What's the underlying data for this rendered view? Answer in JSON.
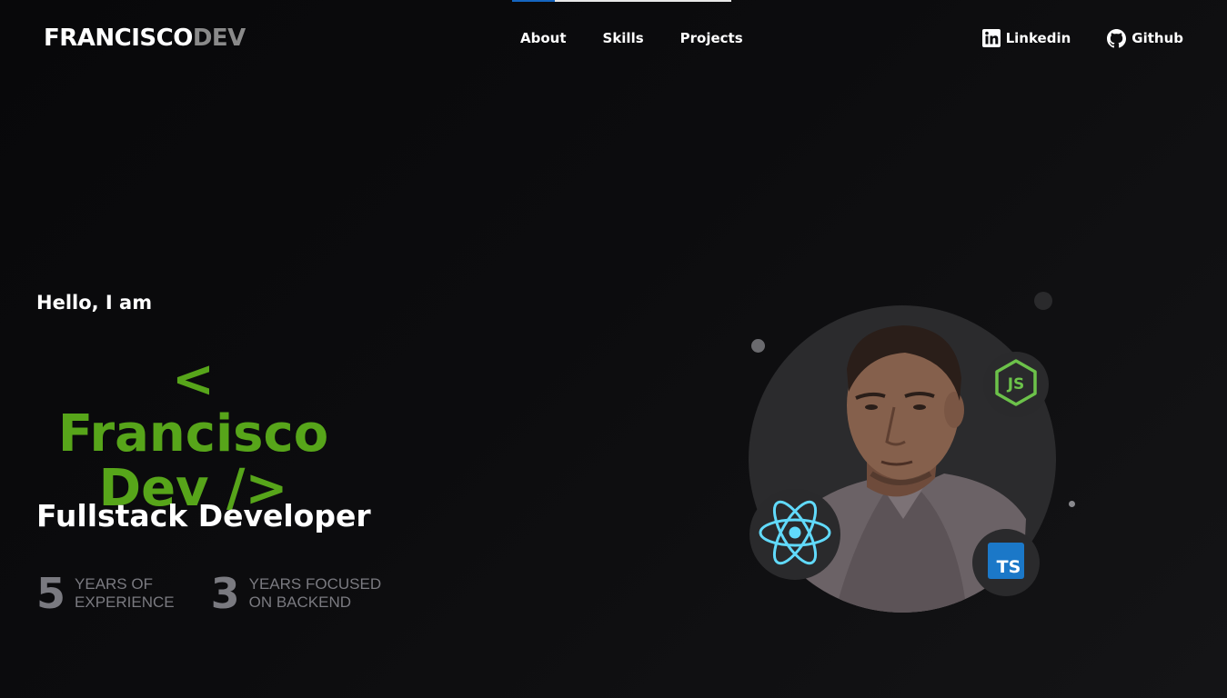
{
  "header": {
    "logo_primary": "FRANCISCO",
    "logo_secondary": "DEV",
    "nav": [
      {
        "label": "About"
      },
      {
        "label": "Skills"
      },
      {
        "label": "Projects"
      }
    ],
    "social": [
      {
        "label": "Linkedin",
        "icon": "linkedin-icon"
      },
      {
        "label": "Github",
        "icon": "github-icon"
      }
    ]
  },
  "hero": {
    "greeting": "Hello, I am",
    "name_line1": "< Francisco",
    "name_line2": "Dev />",
    "role": "Fullstack Developer",
    "stats": [
      {
        "number": "5",
        "label_line1": "YEARS OF",
        "label_line2": "EXPERIENCE"
      },
      {
        "number": "3",
        "label_line1": "YEARS FOCUSED",
        "label_line2": "ON BACKEND"
      }
    ]
  },
  "portrait": {
    "badges": [
      {
        "icon": "nodejs-icon",
        "text": "JS"
      },
      {
        "icon": "react-icon"
      },
      {
        "icon": "typescript-icon",
        "text": "TS"
      }
    ]
  },
  "colors": {
    "accent_green": "#57a51a",
    "muted": "#7a7a80",
    "nav_indicator": "#1565c0",
    "background": "#0b0b0d"
  }
}
